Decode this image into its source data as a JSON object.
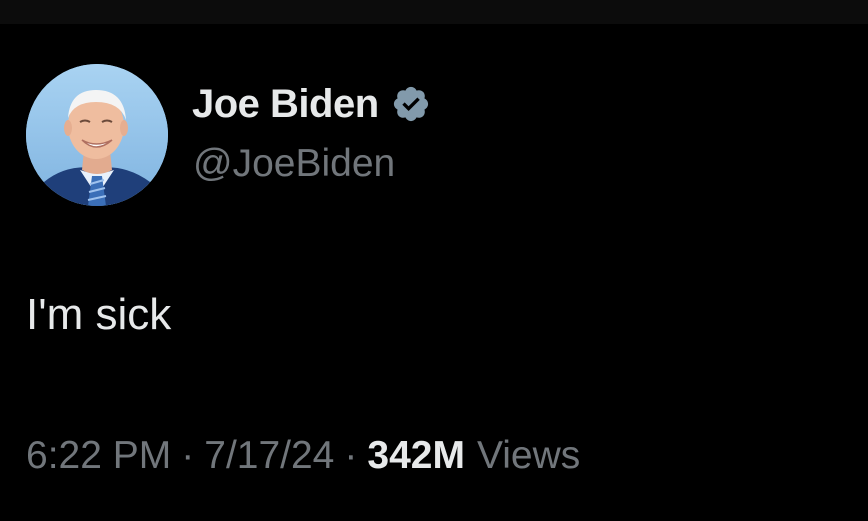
{
  "tweet": {
    "author": {
      "display_name": "Joe Biden",
      "handle": "@JoeBiden",
      "verified_icon": "verified-badge-icon",
      "avatar": "profile-photo"
    },
    "text": "I'm sick",
    "meta": {
      "time": "6:22 PM",
      "separator": "·",
      "date": "7/17/24",
      "views_count": "342M",
      "views_label": "Views"
    }
  },
  "colors": {
    "background": "#000000",
    "primary_text": "#e7e9ea",
    "secondary_text": "#71767b",
    "verified_badge": "#829aab"
  }
}
